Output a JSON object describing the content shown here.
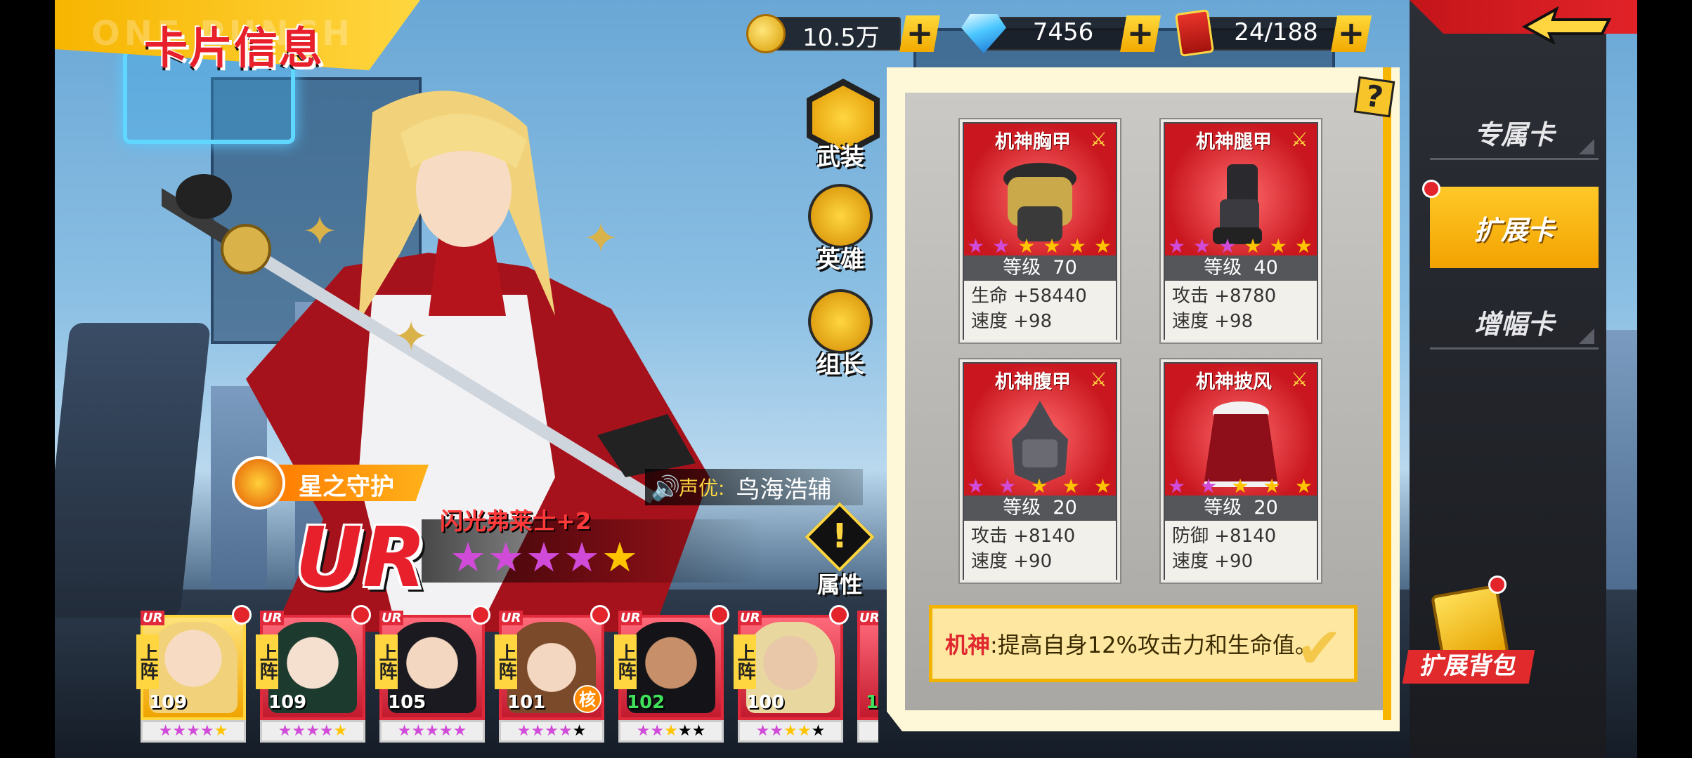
{
  "page_title": {
    "main": "卡片信息",
    "ghost": "ONE PUNCH"
  },
  "currencies": [
    {
      "icon": "gold-coin-icon",
      "value": "10.5万",
      "plus": "+"
    },
    {
      "icon": "diamond-icon",
      "value": "7456",
      "plus": "+"
    },
    {
      "icon": "ticket-icon",
      "value": "24/188",
      "plus": "+"
    }
  ],
  "side_tabs": [
    {
      "label": "专属卡",
      "active": false
    },
    {
      "label": "扩展卡",
      "active": true
    },
    {
      "label": "增幅卡",
      "active": false
    }
  ],
  "help_label": "?",
  "cards": [
    {
      "name": "机神胸甲",
      "level_label": "等级",
      "level": "70",
      "stats": [
        "生命 +58440",
        "速度 +98"
      ],
      "stars_purple": 2,
      "stars_gold": 4
    },
    {
      "name": "机神腿甲",
      "level_label": "等级",
      "level": "40",
      "stats": [
        "攻击 +8780",
        "速度 +98"
      ],
      "stars_purple": 3,
      "stars_gold": 3
    },
    {
      "name": "机神腹甲",
      "level_label": "等级",
      "level": "20",
      "stats": [
        "攻击 +8140",
        "速度 +90"
      ],
      "stars_purple": 2,
      "stars_gold": 3
    },
    {
      "name": "机神披风",
      "level_label": "等级",
      "level": "20",
      "stats": [
        "防御 +8140",
        "速度 +90"
      ],
      "stars_purple": 2,
      "stars_gold": 3
    }
  ],
  "set_effect": {
    "keyword": "机神",
    "text": ":提高自身12%攻击力和生命值。"
  },
  "side_buttons": [
    {
      "label": "武装",
      "icon": "armament-icon"
    },
    {
      "label": "英雄",
      "icon": "hero-eagle-icon"
    },
    {
      "label": "组长",
      "icon": "crown-icon"
    }
  ],
  "star_guard": "星之守护",
  "voice": {
    "label": "声优:",
    "name": "鸟海浩辅"
  },
  "rarity": "UR",
  "character_name": "闪光弗莱士+2",
  "character_stars": {
    "purple": 4,
    "gold": 1
  },
  "attribute_label": "属性",
  "roster": [
    {
      "level": "109",
      "tag": "上阵",
      "rarity": "UR",
      "green": false,
      "selected": true,
      "stars": "★★★★★"
    },
    {
      "level": "109",
      "tag": "上阵",
      "rarity": "UR",
      "green": false,
      "selected": false,
      "stars": "★★★★★"
    },
    {
      "level": "105",
      "tag": "上阵",
      "rarity": "UR",
      "green": false,
      "selected": false,
      "stars": "★★★★★"
    },
    {
      "level": "101",
      "tag": "上阵",
      "rarity": "UR",
      "green": false,
      "selected": false,
      "stars": "★★★★★",
      "core": "核"
    },
    {
      "level": "102",
      "tag": "上阵",
      "rarity": "UR",
      "green": true,
      "selected": false,
      "stars": "★★★★★"
    },
    {
      "level": "100",
      "tag": "上阵",
      "rarity": "UR",
      "green": false,
      "selected": false,
      "stars": "★★★★★"
    },
    {
      "level": "1",
      "tag": "",
      "rarity": "UR",
      "green": true,
      "selected": false,
      "stars": "★"
    }
  ],
  "bag_label": "扩展背包",
  "colors": {
    "accent": "#f7b500",
    "red": "#e8202b",
    "purple_star": "#d14bd9",
    "gold_star": "#ffc400"
  }
}
